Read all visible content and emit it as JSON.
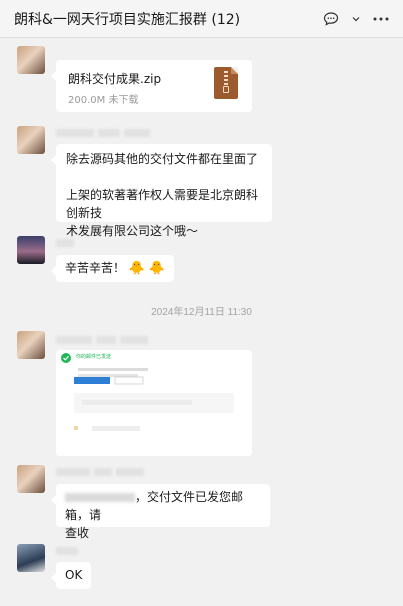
{
  "window": {
    "title": "朗科&一网天行项目实施汇报群 (12)",
    "icons": [
      "chat-bubble-icon",
      "chevron-down-icon",
      "more-icon"
    ]
  },
  "messages": [
    {
      "file": {
        "name": "朗科交付成果.zip",
        "size": "200.0M",
        "status": "未下载",
        "icon": "zip-file-icon"
      }
    },
    {
      "text_lines": [
        "除去源码其他的交付文件都在里面了",
        "",
        "上架的软著著作权人需要是北京朗科创新技",
        "术发展有限公司这个哦～"
      ]
    },
    {
      "text": "辛苦辛苦！",
      "emojis": [
        "🐥",
        "🐥"
      ]
    },
    {
      "timestamp": "2024年12月11日 11:30"
    },
    {
      "screenshot": {
        "heading": "你的邮件已发送",
        "button_primary": "",
        "button_secondary": ""
      }
    },
    {
      "text_lines": [
        "，交付文件已发您邮箱，请",
        "查收"
      ]
    },
    {
      "text": "OK"
    }
  ],
  "colors": {
    "background": "#f1f1f1",
    "bubble": "#ffffff",
    "file_icon": "#9b5b2f",
    "success": "#20b759"
  }
}
